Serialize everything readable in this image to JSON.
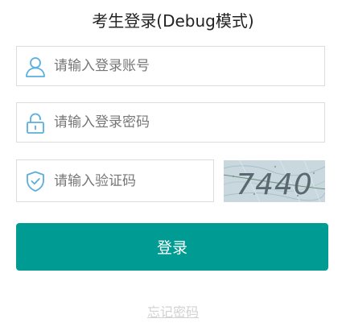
{
  "title": "考生登录(Debug模式)",
  "account": {
    "placeholder": "请输入登录账号",
    "value": "",
    "icon": "user-icon"
  },
  "password": {
    "placeholder": "请输入登录密码",
    "value": "",
    "icon": "lock-icon"
  },
  "captcha": {
    "placeholder": "请输入验证码",
    "value": "",
    "icon": "shield-check-icon",
    "image_text": "7440"
  },
  "login_button": "登录",
  "forgot_link": "忘记密码",
  "colors": {
    "accent": "#009b92",
    "icon": "#5aaee0",
    "border": "#dcdcdc",
    "link": "#d2d2d2"
  }
}
